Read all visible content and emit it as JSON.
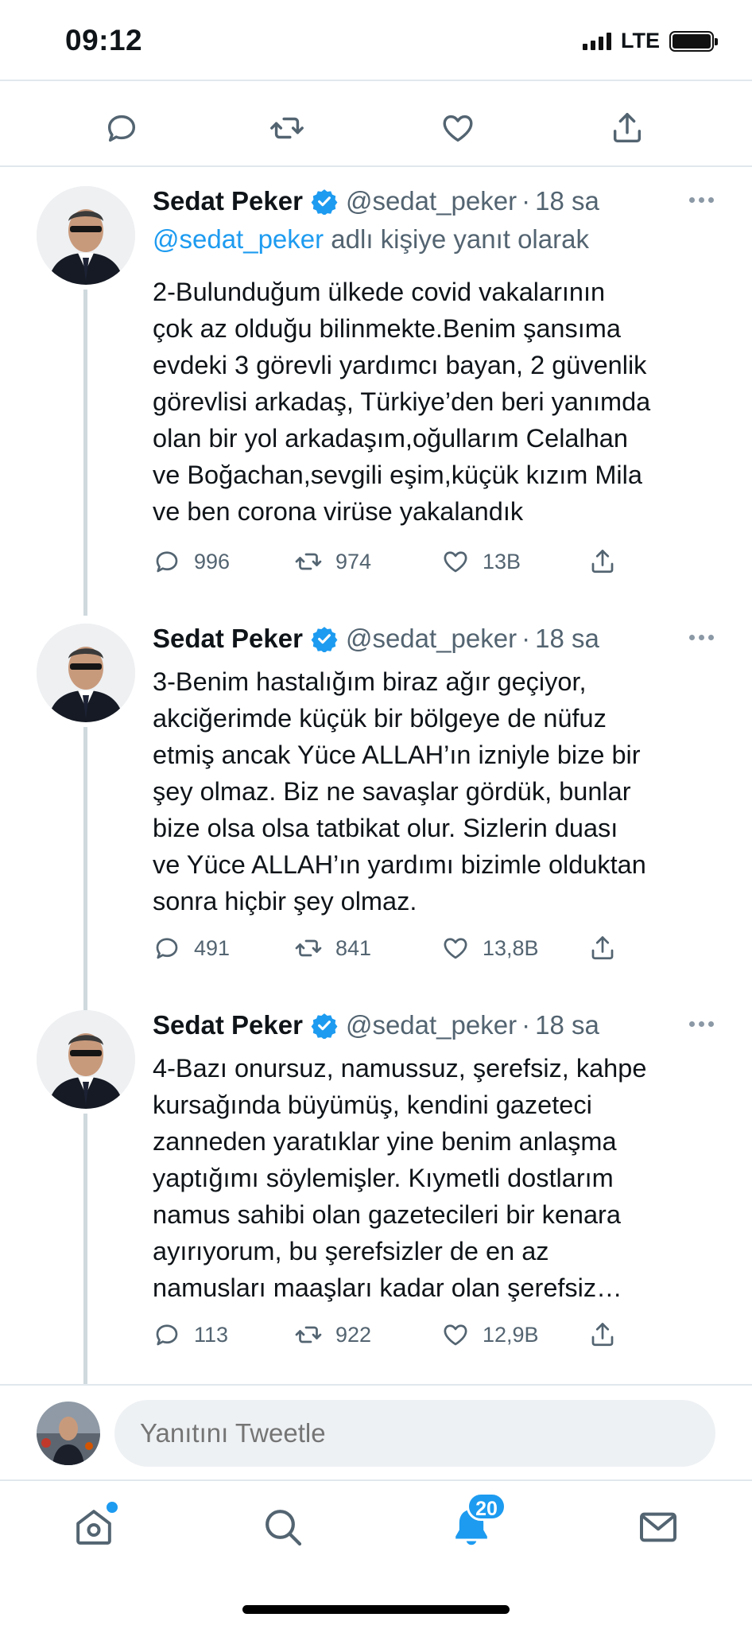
{
  "status_bar": {
    "time": "09:12",
    "network": "LTE"
  },
  "tweets": [
    {
      "name": "Sedat Peker",
      "handle": "@sedat_peker",
      "time": "18 sa",
      "reply_handle": "@sedat_peker",
      "reply_suffix": " adlı kişiye yanıt olarak",
      "text": "2-Bulunduğum ülkede covid vakalarının\nçok az olduğu bilinmekte.Benim şansıma\nevdeki 3 görevli yardımcı bayan, 2 güvenlik\ngörevlisi arkadaş, Türkiye’den beri yanımda\nolan bir yol arkadaşım,oğullarım Celalhan\nve Boğachan,sevgili eşim,küçük kızım Mila\nve ben corona virüse yakalandık",
      "replies": "996",
      "retweets": "974",
      "likes": "13B"
    },
    {
      "name": "Sedat Peker",
      "handle": "@sedat_peker",
      "time": "18 sa",
      "text": "3-Benim hastalığım biraz ağır geçiyor,\nakciğerimde küçük bir bölgeye de nüfuz\netmiş ancak Yüce ALLAH’ın izniyle bize bir\nşey olmaz. Biz ne savaşlar gördük, bunlar\nbize olsa olsa tatbikat olur. Sizlerin duası\nve Yüce ALLAH’ın yardımı bizimle olduktan\nsonra hiçbir şey olmaz.",
      "replies": "491",
      "retweets": "841",
      "likes": "13,8B"
    },
    {
      "name": "Sedat Peker",
      "handle": "@sedat_peker",
      "time": "18 sa",
      "text": "4-Bazı onursuz, namussuz, şerefsiz, kahpe\nkursağında büyümüş, kendini gazeteci\nzanneden yaratıklar yine benim anlaşma\nyaptığımı söylemişler. Kıymetli dostlarım\nnamus sahibi olan gazetecileri bir kenara\nayırıyorum, bu şerefsizler de en az\nnamusları maaşları kadar olan şerefsiz…",
      "replies": "113",
      "retweets": "922",
      "likes": "12,9B"
    }
  ],
  "reply_bar": {
    "placeholder": "Yanıtını Tweetle"
  },
  "tab_bar": {
    "notifications_badge": "20"
  },
  "colors": {
    "accent": "#1d9bf0",
    "secondary_text": "#536471",
    "divider": "#e1e8ed"
  },
  "icons": [
    "reply-icon",
    "retweet-icon",
    "like-icon",
    "share-icon",
    "verified-icon",
    "more-icon",
    "home-icon",
    "search-icon",
    "bell-icon",
    "mail-icon"
  ]
}
